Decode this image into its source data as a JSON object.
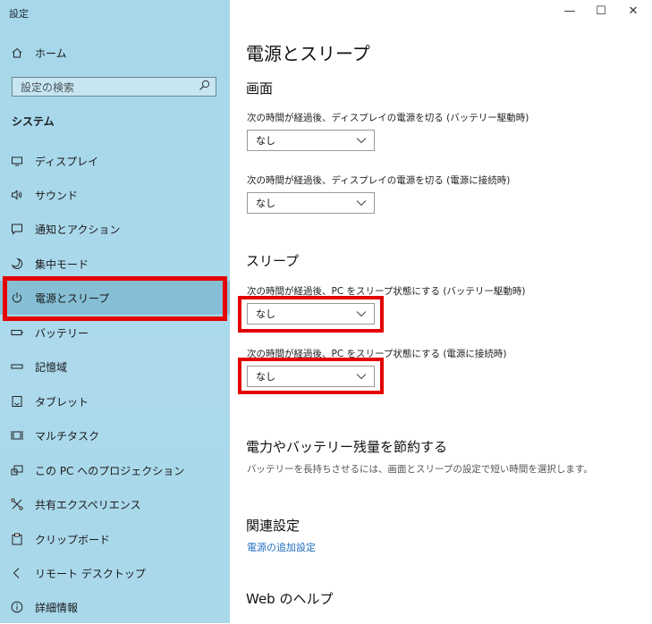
{
  "app": {
    "title": "設定"
  },
  "window_controls": {
    "minimize": "—",
    "maximize": "☐",
    "close": "✕"
  },
  "sidebar": {
    "home": "ホーム",
    "search_placeholder": "設定の検索",
    "section": "システム",
    "items": [
      {
        "label": "ディスプレイ",
        "icon": "monitor-icon"
      },
      {
        "label": "サウンド",
        "icon": "speaker-icon"
      },
      {
        "label": "通知とアクション",
        "icon": "notification-icon"
      },
      {
        "label": "集中モード",
        "icon": "moon-icon"
      },
      {
        "label": "電源とスリープ",
        "icon": "power-icon",
        "selected": true
      },
      {
        "label": "バッテリー",
        "icon": "battery-icon"
      },
      {
        "label": "記憶域",
        "icon": "storage-icon"
      },
      {
        "label": "タブレット",
        "icon": "tablet-icon"
      },
      {
        "label": "マルチタスク",
        "icon": "multitask-icon"
      },
      {
        "label": "この PC へのプロジェクション",
        "icon": "projection-icon"
      },
      {
        "label": "共有エクスペリエンス",
        "icon": "shared-icon"
      },
      {
        "label": "クリップボード",
        "icon": "clipboard-icon"
      },
      {
        "label": "リモート デスクトップ",
        "icon": "remote-icon"
      },
      {
        "label": "詳細情報",
        "icon": "info-icon"
      }
    ]
  },
  "main": {
    "title": "電源とスリープ",
    "screen": {
      "heading": "画面",
      "battery_label": "次の時間が経過後、ディスプレイの電源を切る (バッテリー駆動時)",
      "battery_value": "なし",
      "plugged_label": "次の時間が経過後、ディスプレイの電源を切る (電源に接続時)",
      "plugged_value": "なし"
    },
    "sleep": {
      "heading": "スリープ",
      "battery_label": "次の時間が経過後、PC をスリープ状態にする (バッテリー駆動時)",
      "battery_value": "なし",
      "plugged_label": "次の時間が経過後、PC をスリープ状態にする (電源に接続時)",
      "plugged_value": "なし"
    },
    "save": {
      "heading": "電力やバッテリー残量を節約する",
      "description": "バッテリーを長持ちさせるには、画面とスリープの設定で短い時間を選択します。"
    },
    "related": {
      "heading": "関連設定",
      "link": "電源の追加設定"
    },
    "web_help": {
      "heading": "Web のヘルプ"
    }
  },
  "colors": {
    "highlight": "#e40000",
    "sidebar": "#a8d8ea",
    "link": "#1f6fbf"
  }
}
